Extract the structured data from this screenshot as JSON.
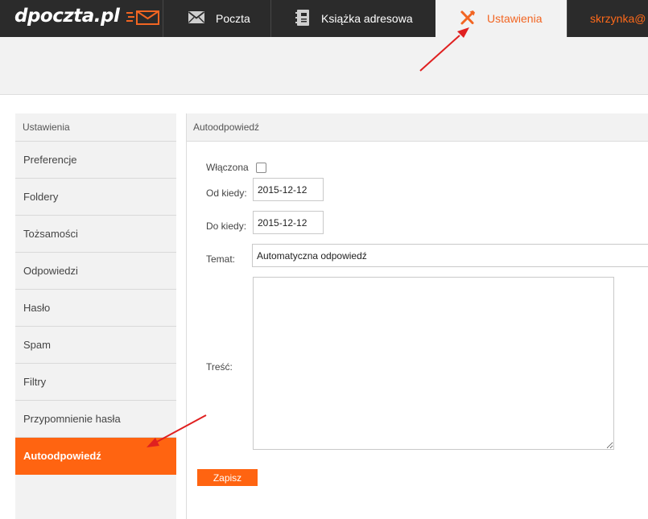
{
  "header": {
    "logo": "dpoczta.pl",
    "nav": [
      {
        "label": "Poczta",
        "icon": "envelope-icon"
      },
      {
        "label": "Książka adresowa",
        "icon": "address-book-icon"
      },
      {
        "label": "Ustawienia",
        "icon": "tools-icon",
        "active": true
      }
    ],
    "user": "skrzynka@"
  },
  "sidebar": {
    "title": "Ustawienia",
    "items": [
      {
        "label": "Preferencje"
      },
      {
        "label": "Foldery"
      },
      {
        "label": "Tożsamości"
      },
      {
        "label": "Odpowiedzi"
      },
      {
        "label": "Hasło"
      },
      {
        "label": "Spam"
      },
      {
        "label": "Filtry"
      },
      {
        "label": "Przypomnienie hasła"
      },
      {
        "label": "Autoodpowiedź",
        "active": true
      }
    ]
  },
  "panel": {
    "title": "Autoodpowiedź",
    "enabled_label": "Włączona",
    "enabled": false,
    "from_label": "Od kiedy:",
    "from_value": "2015-12-12",
    "to_label": "Do kiedy:",
    "to_value": "2015-12-12",
    "subject_label": "Temat:",
    "subject_value": "Automatyczna odpowiedź",
    "body_label": "Treść:",
    "body_value": "",
    "save_label": "Zapisz"
  },
  "colors": {
    "accent": "#ff6411",
    "topbar": "#2b2b2b",
    "annotation_arrow": "#e02020"
  }
}
